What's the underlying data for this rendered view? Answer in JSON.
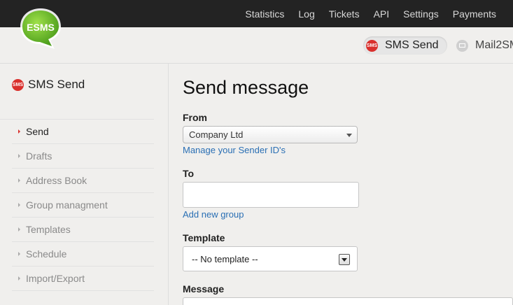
{
  "topnav": {
    "items": [
      "Statistics",
      "Log",
      "Tickets",
      "API",
      "Settings",
      "Payments"
    ]
  },
  "logo": {
    "text": "ESMS",
    "color": "#6dbb2b"
  },
  "services": {
    "sms_send": {
      "label": "SMS Send",
      "icon": "sms-icon"
    },
    "mail2sms": {
      "label": "Mail2SMS",
      "icon": "mail-icon"
    }
  },
  "sidebar": {
    "title": "SMS Send",
    "badge": "SMS",
    "items": [
      {
        "label": "Send",
        "active": true
      },
      {
        "label": "Drafts",
        "active": false
      },
      {
        "label": "Address Book",
        "active": false
      },
      {
        "label": "Group managment",
        "active": false
      },
      {
        "label": "Templates",
        "active": false
      },
      {
        "label": "Schedule",
        "active": false
      },
      {
        "label": "Import/Export",
        "active": false
      }
    ]
  },
  "main": {
    "title": "Send message",
    "from": {
      "label": "From",
      "value": "Company Ltd",
      "link": "Manage your Sender ID's"
    },
    "to": {
      "label": "To",
      "value": "",
      "link": "Add new group"
    },
    "template": {
      "label": "Template",
      "value": "-- No template --"
    },
    "message": {
      "label": "Message",
      "value": ""
    }
  },
  "colors": {
    "topbar": "#232323",
    "accent_red": "#d9302c",
    "link_blue": "#2a6fb4",
    "background": "#f0efed"
  }
}
